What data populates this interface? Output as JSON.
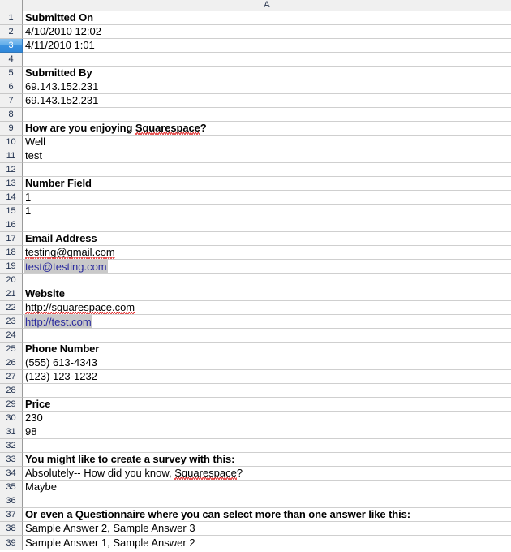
{
  "app": {
    "type": "spreadsheet",
    "column_header_label": "A",
    "selected_row": 3,
    "visible_row_count": 39
  },
  "colors": {
    "header_bg": "#f0f0f0",
    "header_text": "#23304a",
    "gridline": "#cfcfcf",
    "row_separator": "#9a9a9a",
    "selection_blue": "#3b92e0",
    "selection_text": "#ffffff",
    "link_text": "#2b2b9e",
    "link_highlight_bg": "#c9c9c9",
    "spellcheck_underline": "#e02020",
    "cell_text": "#000000"
  },
  "rows": [
    {
      "n": "1",
      "text": "Submitted On",
      "style": "header"
    },
    {
      "n": "2",
      "text": "4/10/2010 12:02",
      "style": "normal"
    },
    {
      "n": "3",
      "text": "4/11/2010 1:01",
      "style": "normal",
      "row_selected": true
    },
    {
      "n": "4",
      "text": "",
      "style": "normal"
    },
    {
      "n": "5",
      "text": "Submitted By",
      "style": "header"
    },
    {
      "n": "6",
      "text": "69.143.152.231",
      "style": "normal"
    },
    {
      "n": "7",
      "text": "69.143.152.231",
      "style": "normal"
    },
    {
      "n": "8",
      "text": "",
      "style": "normal"
    },
    {
      "n": "9",
      "text": "How are you enjoying Squarespace?",
      "style": "header",
      "misspelled": "Squarespace"
    },
    {
      "n": "10",
      "text": "Well",
      "style": "normal"
    },
    {
      "n": "11",
      "text": "test",
      "style": "normal"
    },
    {
      "n": "12",
      "text": "",
      "style": "normal"
    },
    {
      "n": "13",
      "text": "Number Field",
      "style": "header"
    },
    {
      "n": "14",
      "text": "1",
      "style": "normal"
    },
    {
      "n": "15",
      "text": "1",
      "style": "normal"
    },
    {
      "n": "16",
      "text": "",
      "style": "normal"
    },
    {
      "n": "17",
      "text": "Email Address",
      "style": "header"
    },
    {
      "n": "18",
      "text": "testing@gmail.com",
      "style": "normal",
      "misspelled": "testing@gmail.com"
    },
    {
      "n": "19",
      "text": "test@testing.com",
      "style": "link"
    },
    {
      "n": "20",
      "text": "",
      "style": "normal"
    },
    {
      "n": "21",
      "text": "Website",
      "style": "header"
    },
    {
      "n": "22",
      "text": "http://squarespace.com",
      "style": "normal",
      "misspelled": "http://squarespace.com"
    },
    {
      "n": "23",
      "text": "http://test.com",
      "style": "link"
    },
    {
      "n": "24",
      "text": "",
      "style": "normal"
    },
    {
      "n": "25",
      "text": "Phone Number",
      "style": "header"
    },
    {
      "n": "26",
      "text": "(555) 613-4343",
      "style": "normal"
    },
    {
      "n": "27",
      "text": "(123) 123-1232",
      "style": "normal"
    },
    {
      "n": "28",
      "text": "",
      "style": "normal"
    },
    {
      "n": "29",
      "text": "Price",
      "style": "header"
    },
    {
      "n": "30",
      "text": "230",
      "style": "normal"
    },
    {
      "n": "31",
      "text": "98",
      "style": "normal"
    },
    {
      "n": "32",
      "text": "",
      "style": "normal"
    },
    {
      "n": "33",
      "text": "You might like to create a survey with this:",
      "style": "header"
    },
    {
      "n": "34",
      "text": "Absolutely-- How did you know, Squarespace?",
      "style": "normal",
      "misspelled": "Squarespace"
    },
    {
      "n": "35",
      "text": "Maybe",
      "style": "normal"
    },
    {
      "n": "36",
      "text": "",
      "style": "normal"
    },
    {
      "n": "37",
      "text": "Or even a Questionnaire where you can select more than one answer like this:",
      "style": "header"
    },
    {
      "n": "38",
      "text": "Sample Answer 2, Sample Answer 3",
      "style": "normal"
    },
    {
      "n": "39",
      "text": "Sample Answer 1, Sample Answer 2",
      "style": "normal",
      "clipped": true
    }
  ]
}
